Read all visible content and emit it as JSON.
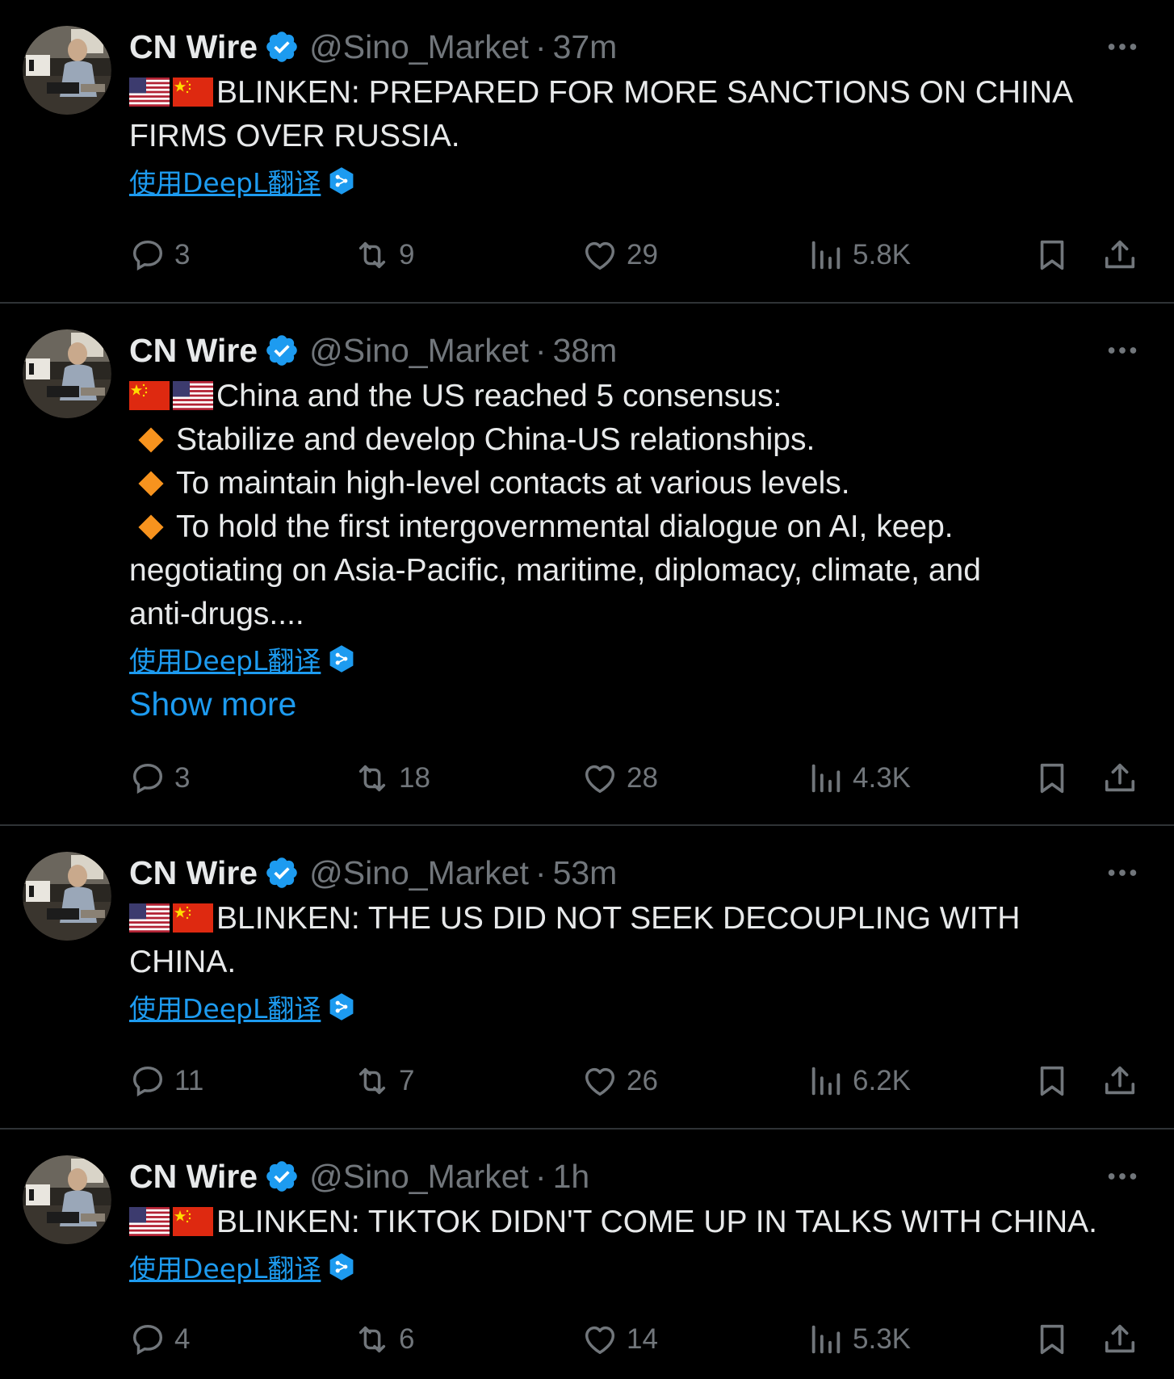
{
  "colors": {
    "background": "#000000",
    "text": "#e7e9ea",
    "muted": "#71767b",
    "link": "#1d9bf0",
    "divider": "#2f3336",
    "verified": "#1d9bf0",
    "bullet": "#f7931e"
  },
  "icons": [
    "more-icon",
    "verified-badge-icon",
    "reply-icon",
    "retweet-icon",
    "like-icon",
    "views-icon",
    "bookmark-icon",
    "share-icon",
    "deepl-icon",
    "us-flag-icon",
    "china-flag-icon"
  ],
  "tweets": [
    {
      "author_name": "CN Wire",
      "handle": "@Sino_Market",
      "separator": "·",
      "time": "37m",
      "lines": [
        "BLINKEN: PREPARED FOR MORE SANCTIONS ON CHINA",
        "FIRMS OVER RUSSIA."
      ],
      "translate_label": "使用DeepL翻译",
      "replies": "3",
      "retweets": "9",
      "likes": "29",
      "views": "5.8K"
    },
    {
      "author_name": "CN Wire",
      "handle": "@Sino_Market",
      "separator": "·",
      "time": "38m",
      "lines": [
        "China and the US reached 5 consensus:",
        "Stabilize and develop China-US relationships.",
        "To maintain high-level contacts at various levels.",
        "To hold the first intergovernmental dialogue on AI, keep.",
        "negotiating on Asia-Pacific, maritime, diplomacy, climate, and",
        "anti-drugs...."
      ],
      "translate_label": "使用DeepL翻译",
      "show_more": "Show more",
      "replies": "3",
      "retweets": "18",
      "likes": "28",
      "views": "4.3K"
    },
    {
      "author_name": "CN Wire",
      "handle": "@Sino_Market",
      "separator": "·",
      "time": "53m",
      "lines": [
        "BLINKEN: THE US DID NOT SEEK DECOUPLING WITH",
        "CHINA."
      ],
      "translate_label": "使用DeepL翻译",
      "replies": "11",
      "retweets": "7",
      "likes": "26",
      "views": "6.2K"
    },
    {
      "author_name": "CN Wire",
      "handle": "@Sino_Market",
      "separator": "·",
      "time": "1h",
      "lines": [
        "BLINKEN: TIKTOK DIDN'T COME UP IN TALKS WITH CHINA."
      ],
      "translate_label": "使用DeepL翻译",
      "replies": "4",
      "retweets": "6",
      "likes": "14",
      "views": "5.3K"
    }
  ]
}
